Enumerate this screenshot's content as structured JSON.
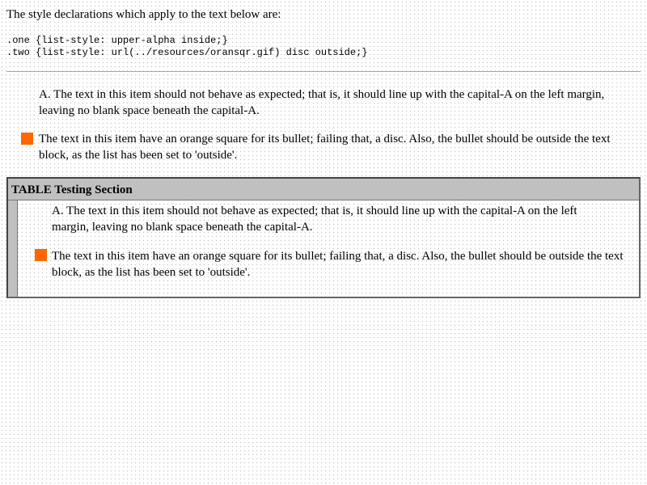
{
  "intro": "The style declarations which apply to the text below are:",
  "css_rules": [
    ".one {list-style: upper-alpha inside;}",
    ".two {list-style: url(../resources/oransqr.gif) disc outside;}"
  ],
  "list": {
    "item_a": "A. The text in this item should not behave as expected; that is, it should line up with the capital-A on the left margin, leaving no blank space beneath the capital-A.",
    "item_b": "The text in this item have an orange square for its bullet; failing that, a disc. Also, the bullet should be outside the text block, as the list has been set to 'outside'."
  },
  "table": {
    "header": "TABLE Testing Section",
    "item_a": "A. The text in this item should not behave as expected; that is, it should line up with the capital-A on the left margin, leaving no blank space beneath the capital-A.",
    "item_b": "The text in this item have an orange square for its bullet; failing that, a disc. Also, the bullet should be outside the text block, as the list has been set to 'outside'."
  },
  "colors": {
    "bullet": "#ff6600",
    "table_header": "#c0c0c0"
  },
  "icons": {
    "bullet": "orange-square-bullet-icon"
  }
}
